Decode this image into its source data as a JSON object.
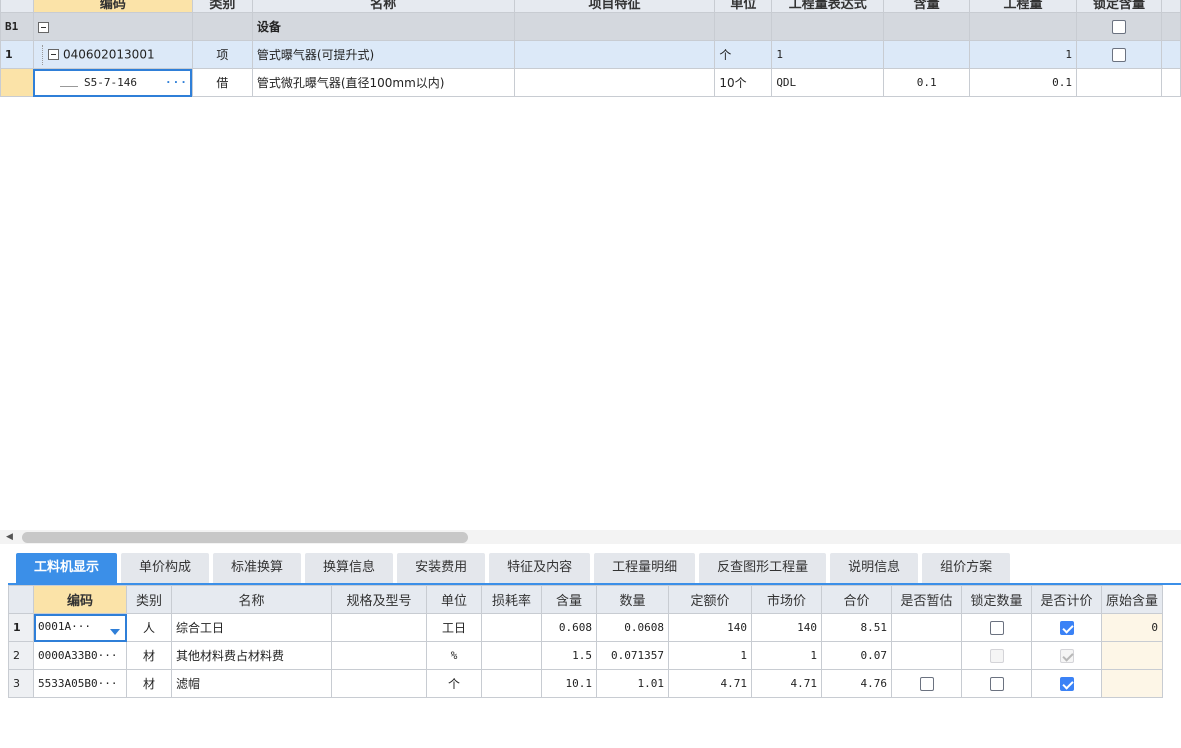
{
  "top_grid": {
    "headers": [
      "编码",
      "类别",
      "名称",
      "项目特征",
      "单位",
      "工程量表达式",
      "含量",
      "工程量",
      "锁定含量"
    ],
    "rows": [
      {
        "seq": "B1",
        "code": "",
        "type": "",
        "name": "设备",
        "feature": "",
        "unit": "",
        "expr": "",
        "content": "",
        "quantity": ""
      },
      {
        "seq": "1",
        "code": "040602013001",
        "type": "项",
        "name": "管式曝气器(可提升式)",
        "feature": "",
        "unit": "个",
        "expr": "1",
        "content": "",
        "quantity": "1"
      },
      {
        "seq": "",
        "code": "S5-7-146",
        "type": "借",
        "name": "管式微孔曝气器(直径100mm以内)",
        "feature": "",
        "unit": "10个",
        "expr": "QDL",
        "content": "0.1",
        "quantity": "0.1"
      }
    ],
    "edit_button_label": "···"
  },
  "tabs": [
    {
      "label": "工料机显示",
      "active": true
    },
    {
      "label": "单价构成",
      "active": false
    },
    {
      "label": "标准换算",
      "active": false
    },
    {
      "label": "换算信息",
      "active": false
    },
    {
      "label": "安装费用",
      "active": false
    },
    {
      "label": "特征及内容",
      "active": false
    },
    {
      "label": "工程量明细",
      "active": false
    },
    {
      "label": "反查图形工程量",
      "active": false
    },
    {
      "label": "说明信息",
      "active": false
    },
    {
      "label": "组价方案",
      "active": false
    }
  ],
  "bottom_grid": {
    "headers": [
      "编码",
      "类别",
      "名称",
      "规格及型号",
      "单位",
      "损耗率",
      "含量",
      "数量",
      "定额价",
      "市场价",
      "合价",
      "是否暂估",
      "锁定数量",
      "是否计价",
      "原始含量"
    ],
    "rows": [
      {
        "seq": "1",
        "code": "0001A···",
        "type": "人",
        "name": "综合工日",
        "spec": "",
        "unit": "工日",
        "loss": "",
        "content": "0.608",
        "qty": "0.0608",
        "quota_price": "140",
        "market_price": "140",
        "total": "8.51",
        "orig": "0"
      },
      {
        "seq": "2",
        "code": "0000A33B0···",
        "type": "材",
        "name": "其他材料费占材料费",
        "spec": "",
        "unit": "%",
        "loss": "",
        "content": "1.5",
        "qty": "0.071357",
        "quota_price": "1",
        "market_price": "1",
        "total": "0.07",
        "orig": ""
      },
      {
        "seq": "3",
        "code": "5533A05B0···",
        "type": "材",
        "name": "滤帽",
        "spec": "",
        "unit": "个",
        "loss": "",
        "content": "10.1",
        "qty": "1.01",
        "quota_price": "4.71",
        "market_price": "4.71",
        "total": "4.76",
        "orig": ""
      }
    ]
  },
  "colors": {
    "accent": "#3b8fe8",
    "header_active": "#fbe3a8",
    "row_selected": "#dce9f8",
    "group_row": "#d4d8de"
  }
}
